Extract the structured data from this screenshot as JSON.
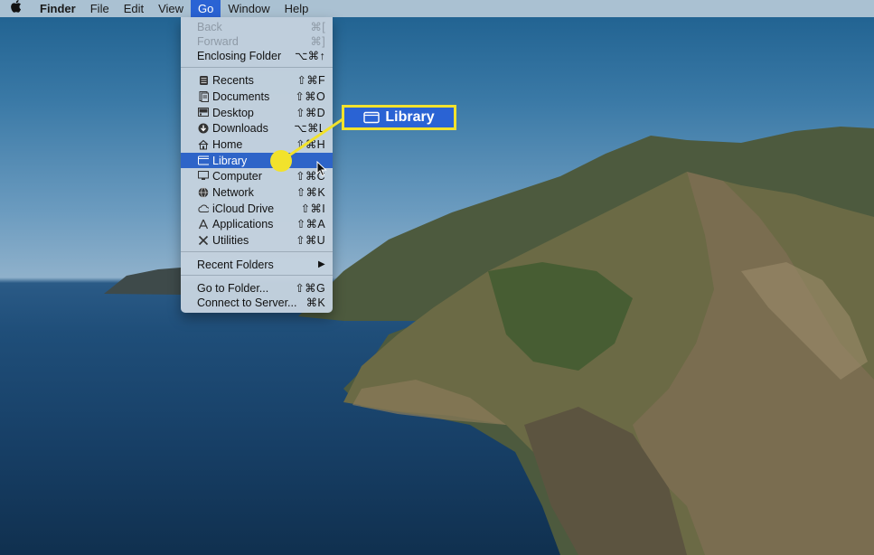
{
  "menubar": {
    "apple": "",
    "app": "Finder",
    "items": [
      "File",
      "Edit",
      "View",
      "Go",
      "Window",
      "Help"
    ]
  },
  "go_menu": {
    "back": {
      "label": "Back",
      "shortcut": "⌘["
    },
    "forward": {
      "label": "Forward",
      "shortcut": "⌘]"
    },
    "enclosing": {
      "label": "Enclosing Folder",
      "shortcut": "⌥⌘↑"
    },
    "recents": {
      "label": "Recents",
      "shortcut": "⇧⌘F"
    },
    "documents": {
      "label": "Documents",
      "shortcut": "⇧⌘O"
    },
    "desktop": {
      "label": "Desktop",
      "shortcut": "⇧⌘D"
    },
    "downloads": {
      "label": "Downloads",
      "shortcut": "⌥⌘L"
    },
    "home": {
      "label": "Home",
      "shortcut": "⇧⌘H"
    },
    "library": {
      "label": "Library",
      "shortcut": ""
    },
    "computer": {
      "label": "Computer",
      "shortcut": "⇧⌘C"
    },
    "network": {
      "label": "Network",
      "shortcut": "⇧⌘K"
    },
    "icloud": {
      "label": "iCloud Drive",
      "shortcut": "⇧⌘I"
    },
    "applications": {
      "label": "Applications",
      "shortcut": "⇧⌘A"
    },
    "utilities": {
      "label": "Utilities",
      "shortcut": "⇧⌘U"
    },
    "recent_folders": {
      "label": "Recent Folders",
      "shortcut": "▶"
    },
    "go_to_folder": {
      "label": "Go to Folder...",
      "shortcut": "⇧⌘G"
    },
    "connect_server": {
      "label": "Connect to Server...",
      "shortcut": "⌘K"
    }
  },
  "callout": {
    "label": "Library"
  },
  "colors": {
    "highlight": "#2e64c8",
    "callout_border": "#f2e22c",
    "pointer_dot": "#f2e22c"
  }
}
